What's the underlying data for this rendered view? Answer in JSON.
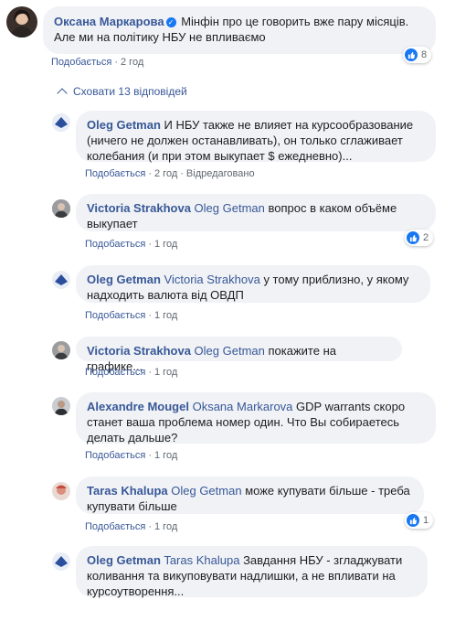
{
  "top_comment": {
    "author": "Оксана Маркарова",
    "line1": "Мінфін про це говорить вже пару місяців.",
    "line2": "Але ми на політику НБУ не впливаємо",
    "like_label": "Подобається",
    "time": "2 год",
    "reaction_count": "8"
  },
  "hide_replies_label": "Сховати 13 відповідей",
  "replies": [
    {
      "author": "Oleg Getman",
      "lines": [
        "И НБУ также не влияет на курсообразование",
        "(ничего не должен останавливать), он только сглаживает",
        "колебания (и при этом выкупает $ ежедневно)..."
      ],
      "like_label": "Подобається",
      "time": "2 год",
      "edited": "Відредаговано"
    },
    {
      "author": "Victoria Strakhova",
      "mention": "Oleg Getman",
      "lines": [
        "вопрос в каком объёме",
        "выкупает"
      ],
      "like_label": "Подобається",
      "time": "1 год",
      "reaction_count": "2"
    },
    {
      "author": "Oleg Getman",
      "mention": "Victoria Strakhova",
      "lines": [
        "у тому приблизно, у якому",
        "надходить валюта від ОВДП"
      ],
      "like_label": "Подобається",
      "time": "1 год"
    },
    {
      "author": "Victoria Strakhova",
      "mention": "Oleg Getman",
      "lines": [
        "покажите на графике..."
      ],
      "like_label": "Подобається",
      "time": "1 год"
    },
    {
      "author": "Alexandre Mougel",
      "mention": "Oksana Markarova",
      "lines": [
        "GDP warrants скоро",
        "станет ваша проблема номер один. Что Вы собираетесь",
        "делать дальше?"
      ],
      "like_label": "Подобається",
      "time": "1 год"
    },
    {
      "author": "Taras Khalupa",
      "mention": "Oleg Getman",
      "lines": [
        "може купувати більше - треба",
        "купувати більше"
      ],
      "like_label": "Подобається",
      "time": "1 год",
      "reaction_count": "1"
    },
    {
      "author": "Oleg Getman",
      "mention": "Taras Khalupa",
      "lines": [
        "Завдання НБУ - згладжувати",
        "коливання та викуповувати надлишки, а не впливати на",
        "курсоутворення..."
      ]
    }
  ],
  "colors": {
    "link": "#385898",
    "bubble": "#f0f2f5",
    "like_badge": "#1877f2",
    "meta": "#606770"
  },
  "icons": {
    "verified": "verified-badge-icon",
    "like": "thumbs-up-icon",
    "hide": "chevron-up-icon"
  }
}
